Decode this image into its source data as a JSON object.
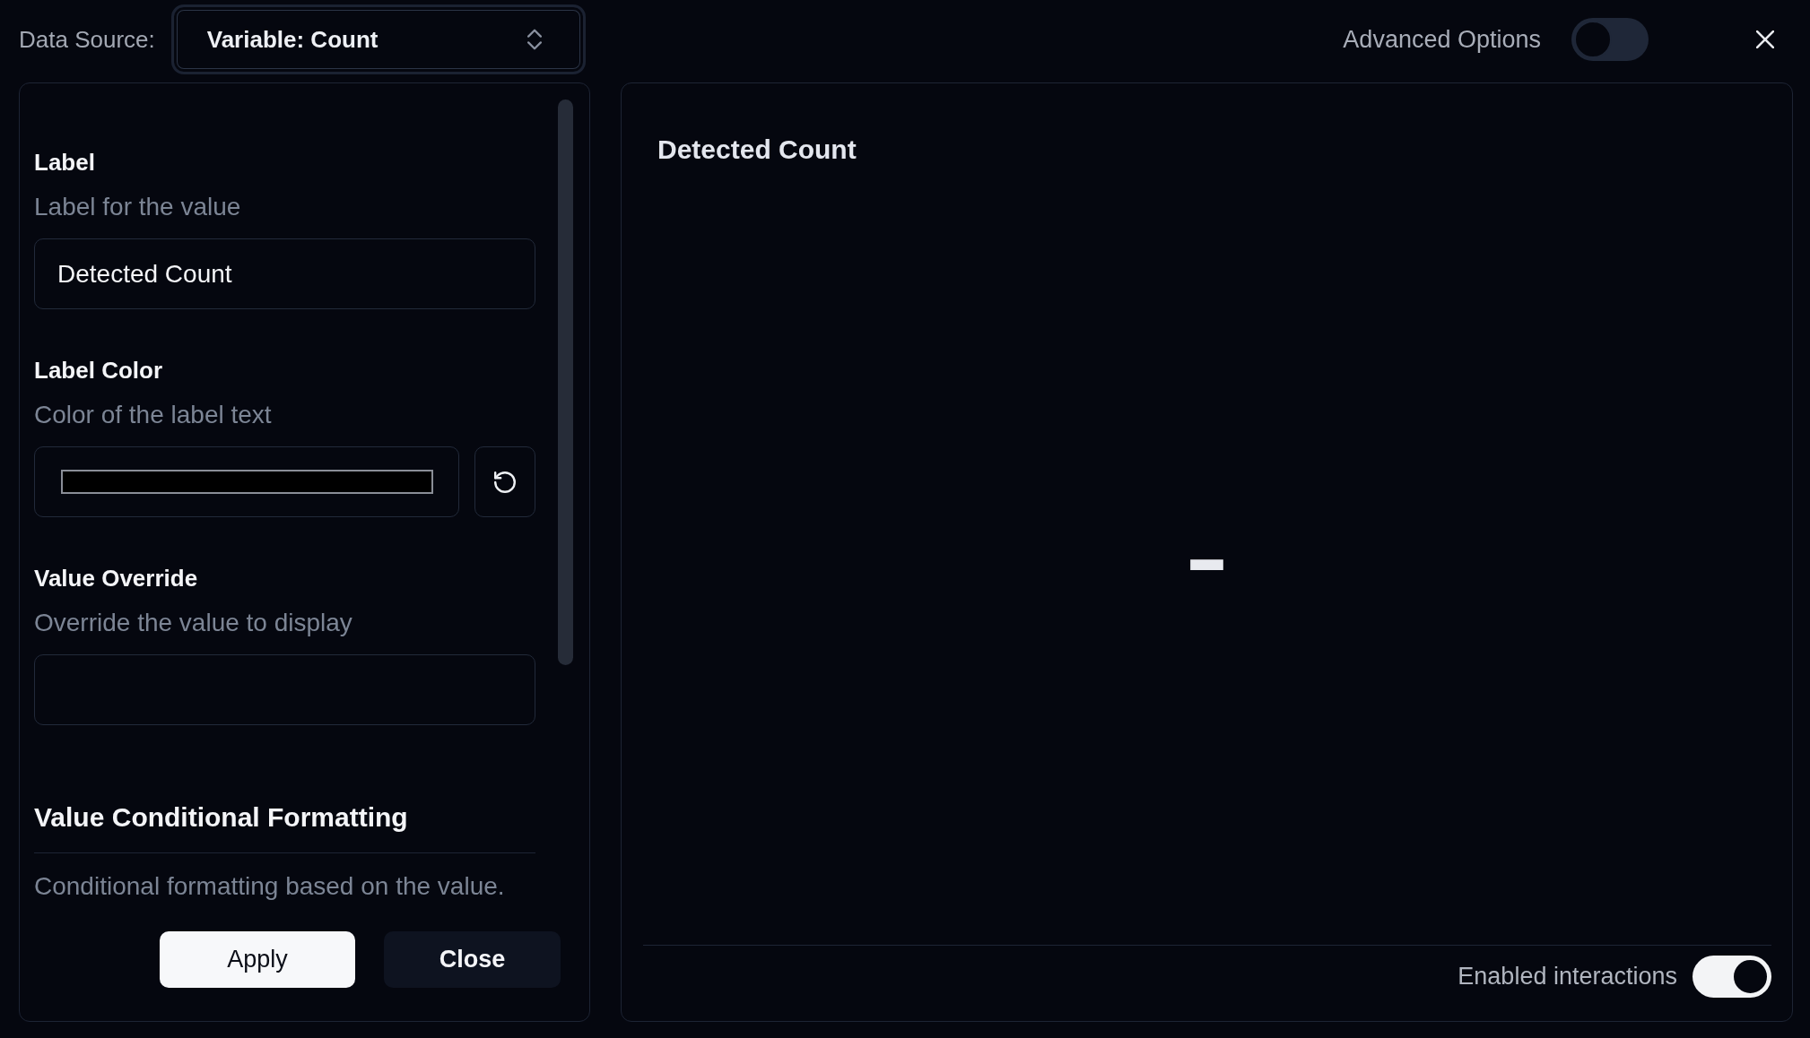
{
  "data_source": {
    "label": "Data Source:",
    "value": "Variable: Count"
  },
  "advanced_options": {
    "label": "Advanced Options",
    "on": false
  },
  "settings": {
    "fields": [
      {
        "kind": "text",
        "title": "Label",
        "description": "Label for the value",
        "value": "Detected Count"
      },
      {
        "kind": "color",
        "title": "Label Color",
        "description": "Color of the label text",
        "color": "#000000"
      },
      {
        "kind": "text",
        "title": "Value Override",
        "description": "Override the value to display"
      }
    ],
    "section": {
      "title": "Value Conditional Formatting",
      "description": "Conditional formatting based on the value."
    },
    "buttons": [
      {
        "label": "Apply",
        "kind": "primary"
      },
      {
        "label": "Close",
        "kind": "secondary"
      }
    ]
  },
  "preview": {
    "title": "Detected Count",
    "value": "-",
    "interactions": {
      "label": "Enabled interactions",
      "on": true
    }
  }
}
